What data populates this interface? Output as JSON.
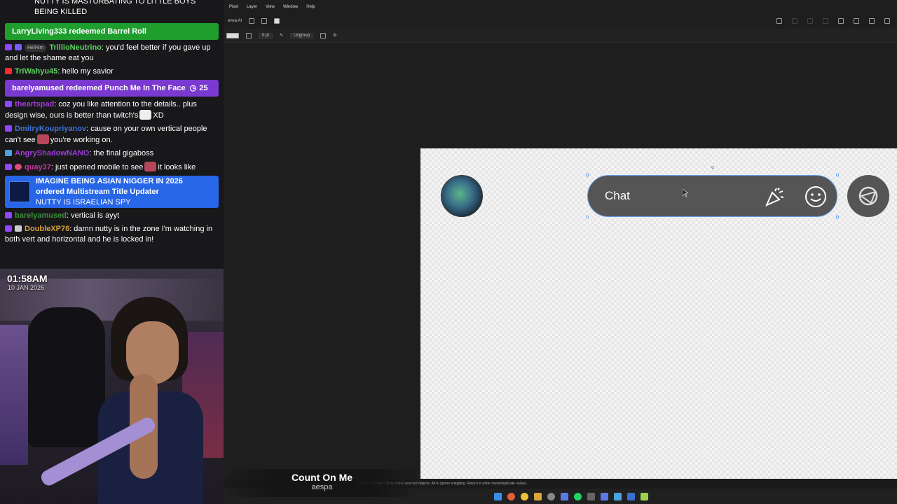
{
  "chat": {
    "top_message": "NUTTY IS MASTURBATING TO LITTLE BOYS BEING KILLED",
    "redeem1": "LarryLiving333 redeemed Barrel Roll",
    "m1": {
      "name": "TrillioNeutrino",
      "pronoun": "He/Him",
      "text": ": you'd feel better if you gave up and let the shame eat you",
      "color": "#5fd35f"
    },
    "m2": {
      "name": "TriWahyu45",
      "text": ": hello my savior",
      "color": "#5fd35f"
    },
    "redeem2": {
      "text": "barelyamused redeemed Punch Me In The Face",
      "cost": "25"
    },
    "m3": {
      "name": "theartspad",
      "text_a": ": coz you like attention to the details.. plus design wise, ours is better than twitch's",
      "text_b": "XD",
      "color": "#a33bd6"
    },
    "m4": {
      "name": "DmitryKoupriyanov",
      "text_a": ": cause on your own vertical people can't see",
      "text_b": "you're working on.",
      "color": "#3c74d9"
    },
    "m5": {
      "name": "AngryShadowNANO",
      "text": ": the final gigaboss",
      "color": "#9c3bd6"
    },
    "m6": {
      "name": "quay37",
      "text_a": ": just opened mobile to see",
      "text_b": "it looks like",
      "color": "#c1359e"
    },
    "alert": {
      "line1": "IMAGINE BEING ASIAN NIGGER IN 2026",
      "line2": "ordered Multistream Title Updater",
      "line3": "NUTTY IS ISRAELIAN SPY"
    },
    "m7": {
      "name": "barelyamused",
      "text": ": vertical is ayyt",
      "color": "#3c8f3c"
    },
    "m8": {
      "name": "DoubleXP76",
      "text": ": damn nutty is in the zone I'm watching in both vert and horizontal and he is locked in!",
      "color": "#d6a23b"
    }
  },
  "webcam": {
    "time": "01:58AM",
    "date": "10 JAN 2026"
  },
  "menubar": {
    "items": [
      "Pixel",
      "Layer",
      "View",
      "Window",
      "Help"
    ]
  },
  "toolbar1": {
    "left_label": "enva AI"
  },
  "toolbar2": {
    "stroke_value": "0 pt",
    "ungroup_label": "Ungroup"
  },
  "canvas": {
    "chat_placeholder": "Chat"
  },
  "statusbar": {
    "text": "Shift to constrain. Ctrl to clone selected objects. Alt to ignore snapping. Return to enter move/duplicate values."
  },
  "nowplaying": {
    "title": "Count On Me",
    "artist": "aespa"
  }
}
